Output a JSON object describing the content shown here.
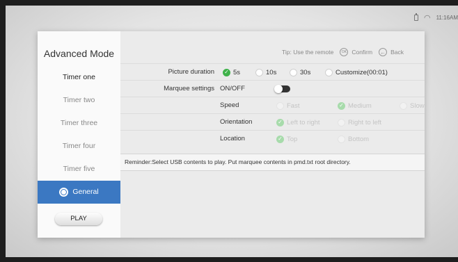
{
  "status_bar": {
    "time": "11:16AM",
    "battery_icon": "battery-icon",
    "wifi_icon": "wifi-icon"
  },
  "sidebar": {
    "title": "Advanced Mode",
    "items": [
      {
        "label": "Timer one",
        "state": "selected"
      },
      {
        "label": "Timer two"
      },
      {
        "label": "Timer three"
      },
      {
        "label": "Timer four"
      },
      {
        "label": "Timer five"
      },
      {
        "label": "General",
        "state": "active",
        "icon": "gear-icon"
      }
    ],
    "play_label": "PLAY"
  },
  "tip": {
    "text": "Tip: Use the remote",
    "ok_glyph": "OK",
    "confirm_label": "Confirm",
    "back_glyph": "←",
    "back_label": "Back"
  },
  "settings": {
    "picture_duration": {
      "label": "Picture duration",
      "options": [
        "5s",
        "10s",
        "30s",
        "Customize(00:01)"
      ],
      "selected": "5s"
    },
    "marquee": {
      "label": "Marquee settings",
      "toggle_label": "ON/OFF",
      "speed": {
        "label": "Speed",
        "options": [
          "Fast",
          "Medium",
          "Slow"
        ],
        "selected": "Medium"
      },
      "orientation": {
        "label": "Orientation",
        "options": [
          "Left to right",
          "Right to left"
        ],
        "selected": "Left to right"
      },
      "location": {
        "label": "Location",
        "options": [
          "Top",
          "Bottom"
        ],
        "selected": "Top"
      }
    }
  },
  "reminder": "Reminder:Select USB contents to play. Put marquee contents in pmd.txt root directory.",
  "colors": {
    "accent": "#3b78c2",
    "check": "#3fb24a"
  }
}
